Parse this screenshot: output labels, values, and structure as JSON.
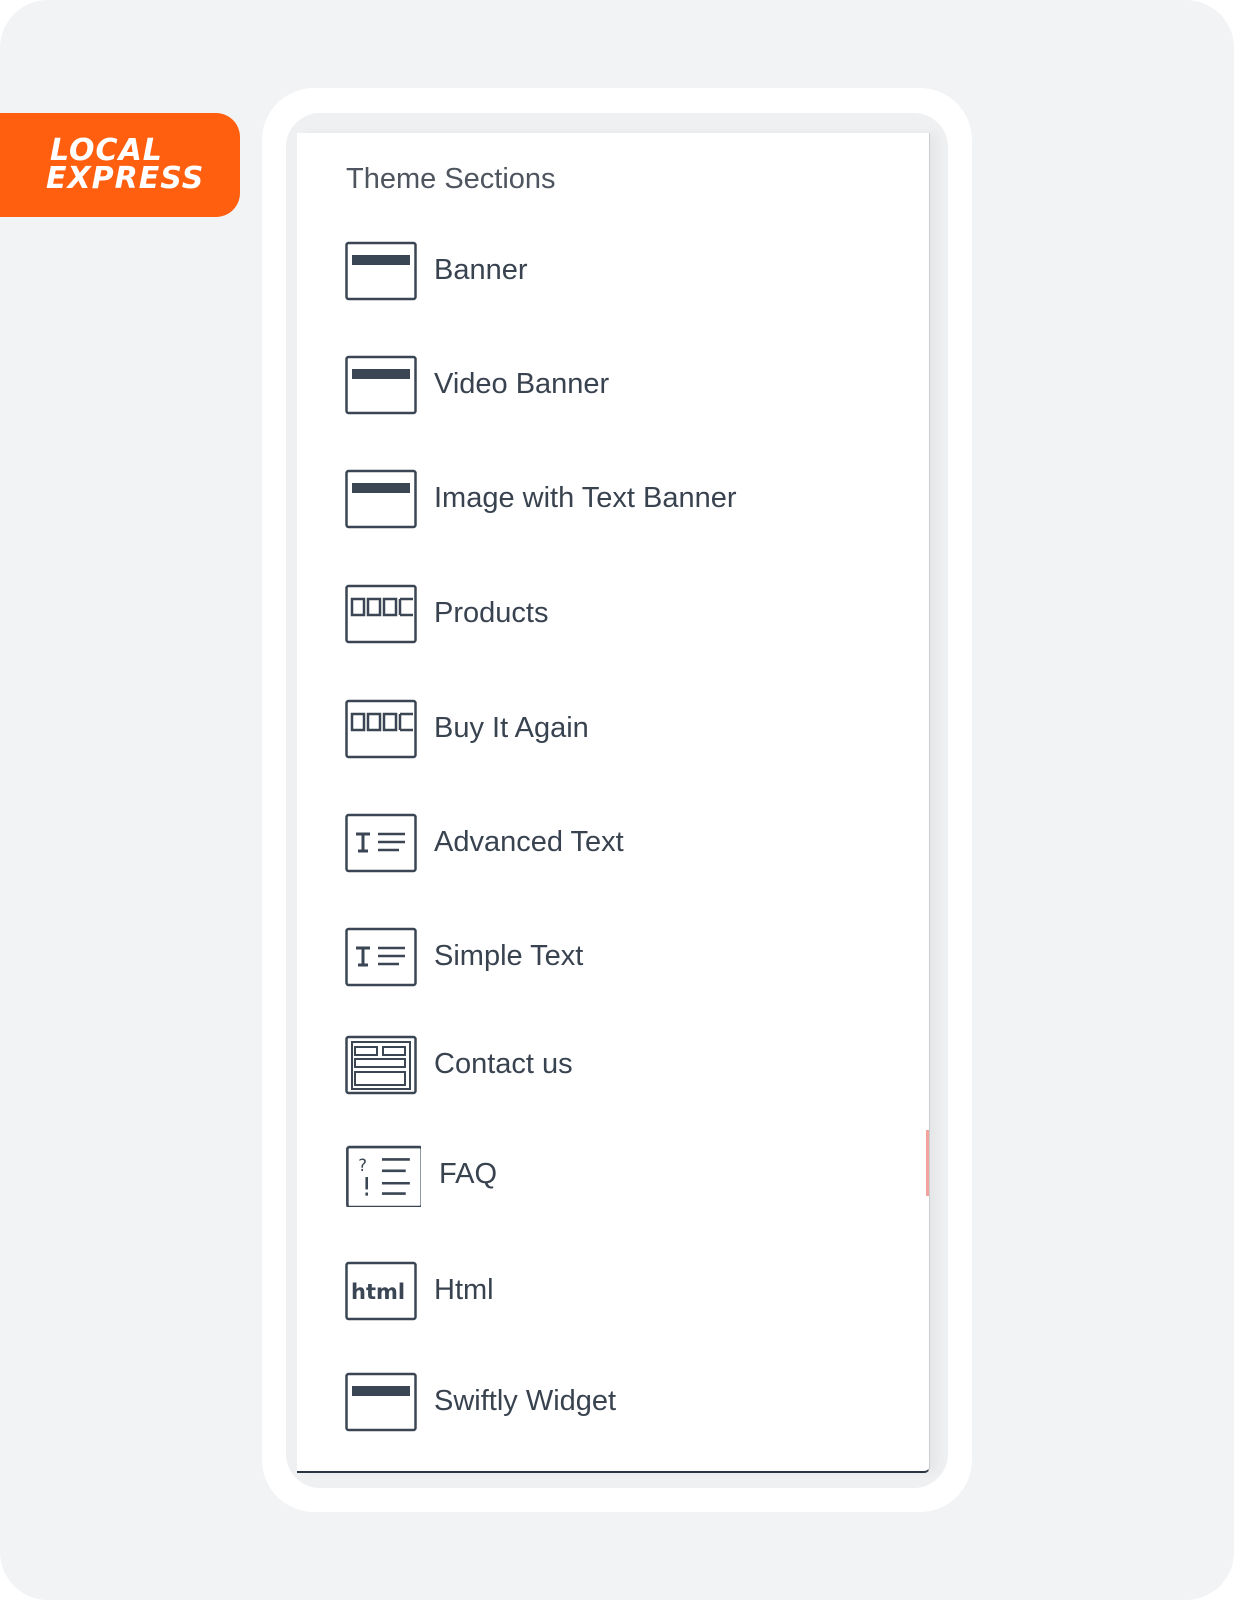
{
  "brand": {
    "logo_line1": "LOCAL",
    "logo_line2": "EXPRESS",
    "accent_color": "#ff5f0f"
  },
  "panel": {
    "title": "Theme Sections"
  },
  "sections": [
    {
      "label": "Banner",
      "icon": "banner-icon"
    },
    {
      "label": "Video Banner",
      "icon": "video-banner-icon"
    },
    {
      "label": "Image with Text Banner",
      "icon": "image-text-banner-icon"
    },
    {
      "label": "Products",
      "icon": "products-grid-icon"
    },
    {
      "label": "Buy It Again",
      "icon": "buy-again-grid-icon"
    },
    {
      "label": "Advanced Text",
      "icon": "text-icon"
    },
    {
      "label": "Simple Text",
      "icon": "text-icon"
    },
    {
      "label": "Contact us",
      "icon": "contact-form-icon"
    },
    {
      "label": "FAQ",
      "icon": "faq-icon"
    },
    {
      "label": "Html",
      "icon": "html-icon"
    },
    {
      "label": "Swiftly Widget",
      "icon": "widget-banner-icon"
    }
  ]
}
